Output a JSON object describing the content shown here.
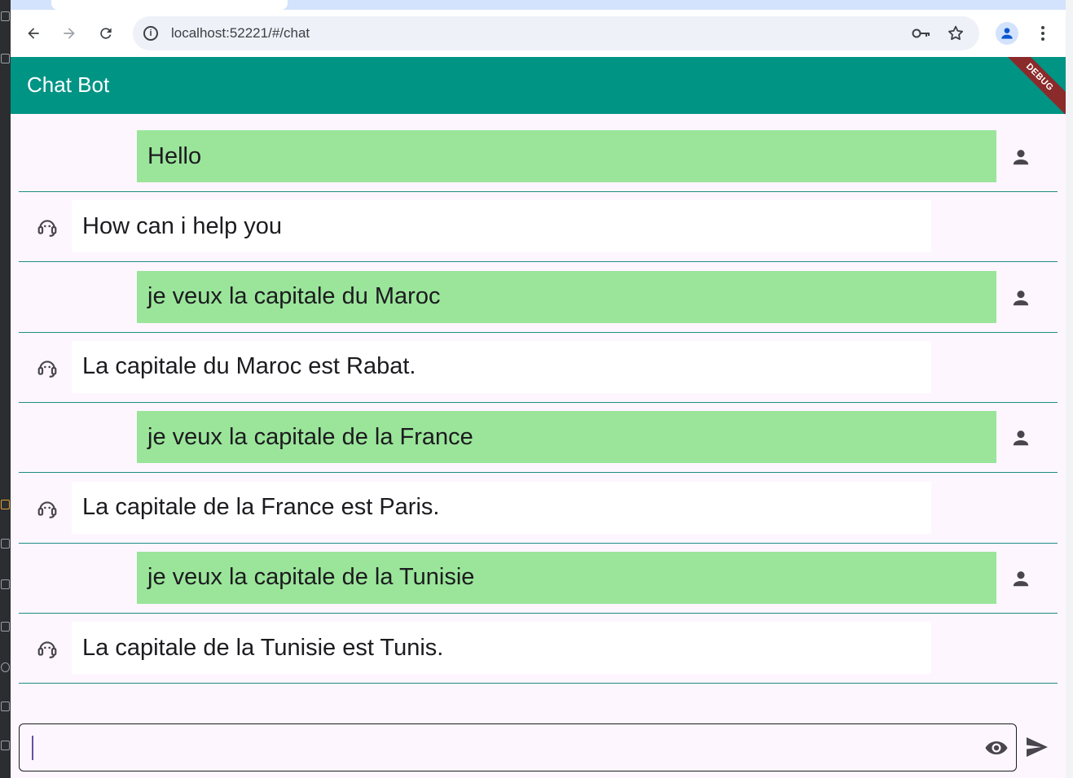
{
  "browser": {
    "url": "localhost:52221/#/chat"
  },
  "app": {
    "title": "Chat Bot",
    "debug_label": "DEBUG"
  },
  "messages": [
    {
      "sender": "user",
      "text": "Hello"
    },
    {
      "sender": "bot",
      "text": "How can i help you"
    },
    {
      "sender": "user",
      "text": "je veux la capitale du Maroc"
    },
    {
      "sender": "bot",
      "text": "La capitale du Maroc est Rabat."
    },
    {
      "sender": "user",
      "text": "je veux la capitale de la France"
    },
    {
      "sender": "bot",
      "text": "La capitale de la France est Paris."
    },
    {
      "sender": "user",
      "text": "je veux la capitale de la Tunisie"
    },
    {
      "sender": "bot",
      "text": "La capitale de la Tunisie est Tunis."
    }
  ],
  "composer": {
    "value": "",
    "placeholder": ""
  },
  "colors": {
    "appbar": "#009485",
    "user_bubble": "#9ae59a",
    "bot_bubble": "#ffffff",
    "background": "#fdf6fe",
    "divider": "#1e8d84"
  }
}
